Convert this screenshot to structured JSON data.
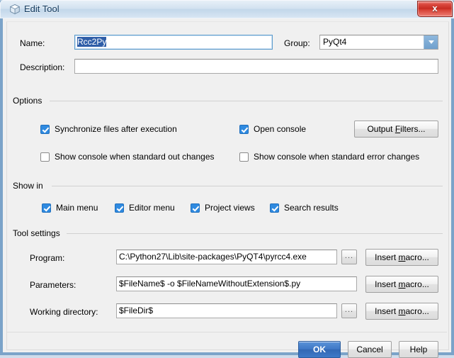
{
  "window": {
    "title": "Edit Tool",
    "icon": "cube-icon",
    "close_label": "x",
    "accent_blue": "#3267b4",
    "checkbox_blue": "#2f8ae0",
    "selection_blue": "#2f5ea8",
    "close_red": "#c62a20"
  },
  "fields": {
    "name_label": "Name:",
    "name_value": "Rcc2Py",
    "name_selected": true,
    "group_label": "Group:",
    "group_value": "PyQt4",
    "description_label": "Description:",
    "description_value": ""
  },
  "options": {
    "title": "Options",
    "checkboxes": [
      {
        "label": "Synchronize files after execution",
        "checked": true
      },
      {
        "label": "Open console",
        "checked": true
      },
      {
        "label": "Show console when standard out changes",
        "checked": false
      },
      {
        "label": "Show console when standard error changes",
        "checked": false
      }
    ],
    "output_filters_button": "Output Filters...",
    "output_filters_mnemonic": "F"
  },
  "show_in": {
    "title": "Show in",
    "checkboxes": [
      {
        "label": "Main menu",
        "checked": true
      },
      {
        "label": "Editor menu",
        "checked": true
      },
      {
        "label": "Project views",
        "checked": true
      },
      {
        "label": "Search results",
        "checked": true
      }
    ]
  },
  "tool_settings": {
    "title": "Tool settings",
    "rows": [
      {
        "label": "Program:",
        "value": "C:\\Python27\\Lib\\site-packages\\PyQT4\\pyrcc4.exe",
        "has_browse": true,
        "browse_label": "...",
        "macro_label": "Insert macro...",
        "macro_mnemonic": "m"
      },
      {
        "label": "Parameters:",
        "value": "$FileName$ -o $FileNameWithoutExtension$.py",
        "has_browse": false,
        "browse_label": "",
        "macro_label": "Insert macro...",
        "macro_mnemonic": "m"
      },
      {
        "label": "Working directory:",
        "value": "$FileDir$",
        "has_browse": true,
        "browse_label": "...",
        "macro_label": "Insert macro...",
        "macro_mnemonic": "m"
      }
    ]
  },
  "footer": {
    "ok_label": "OK",
    "cancel_label": "Cancel",
    "help_label": "Help"
  }
}
